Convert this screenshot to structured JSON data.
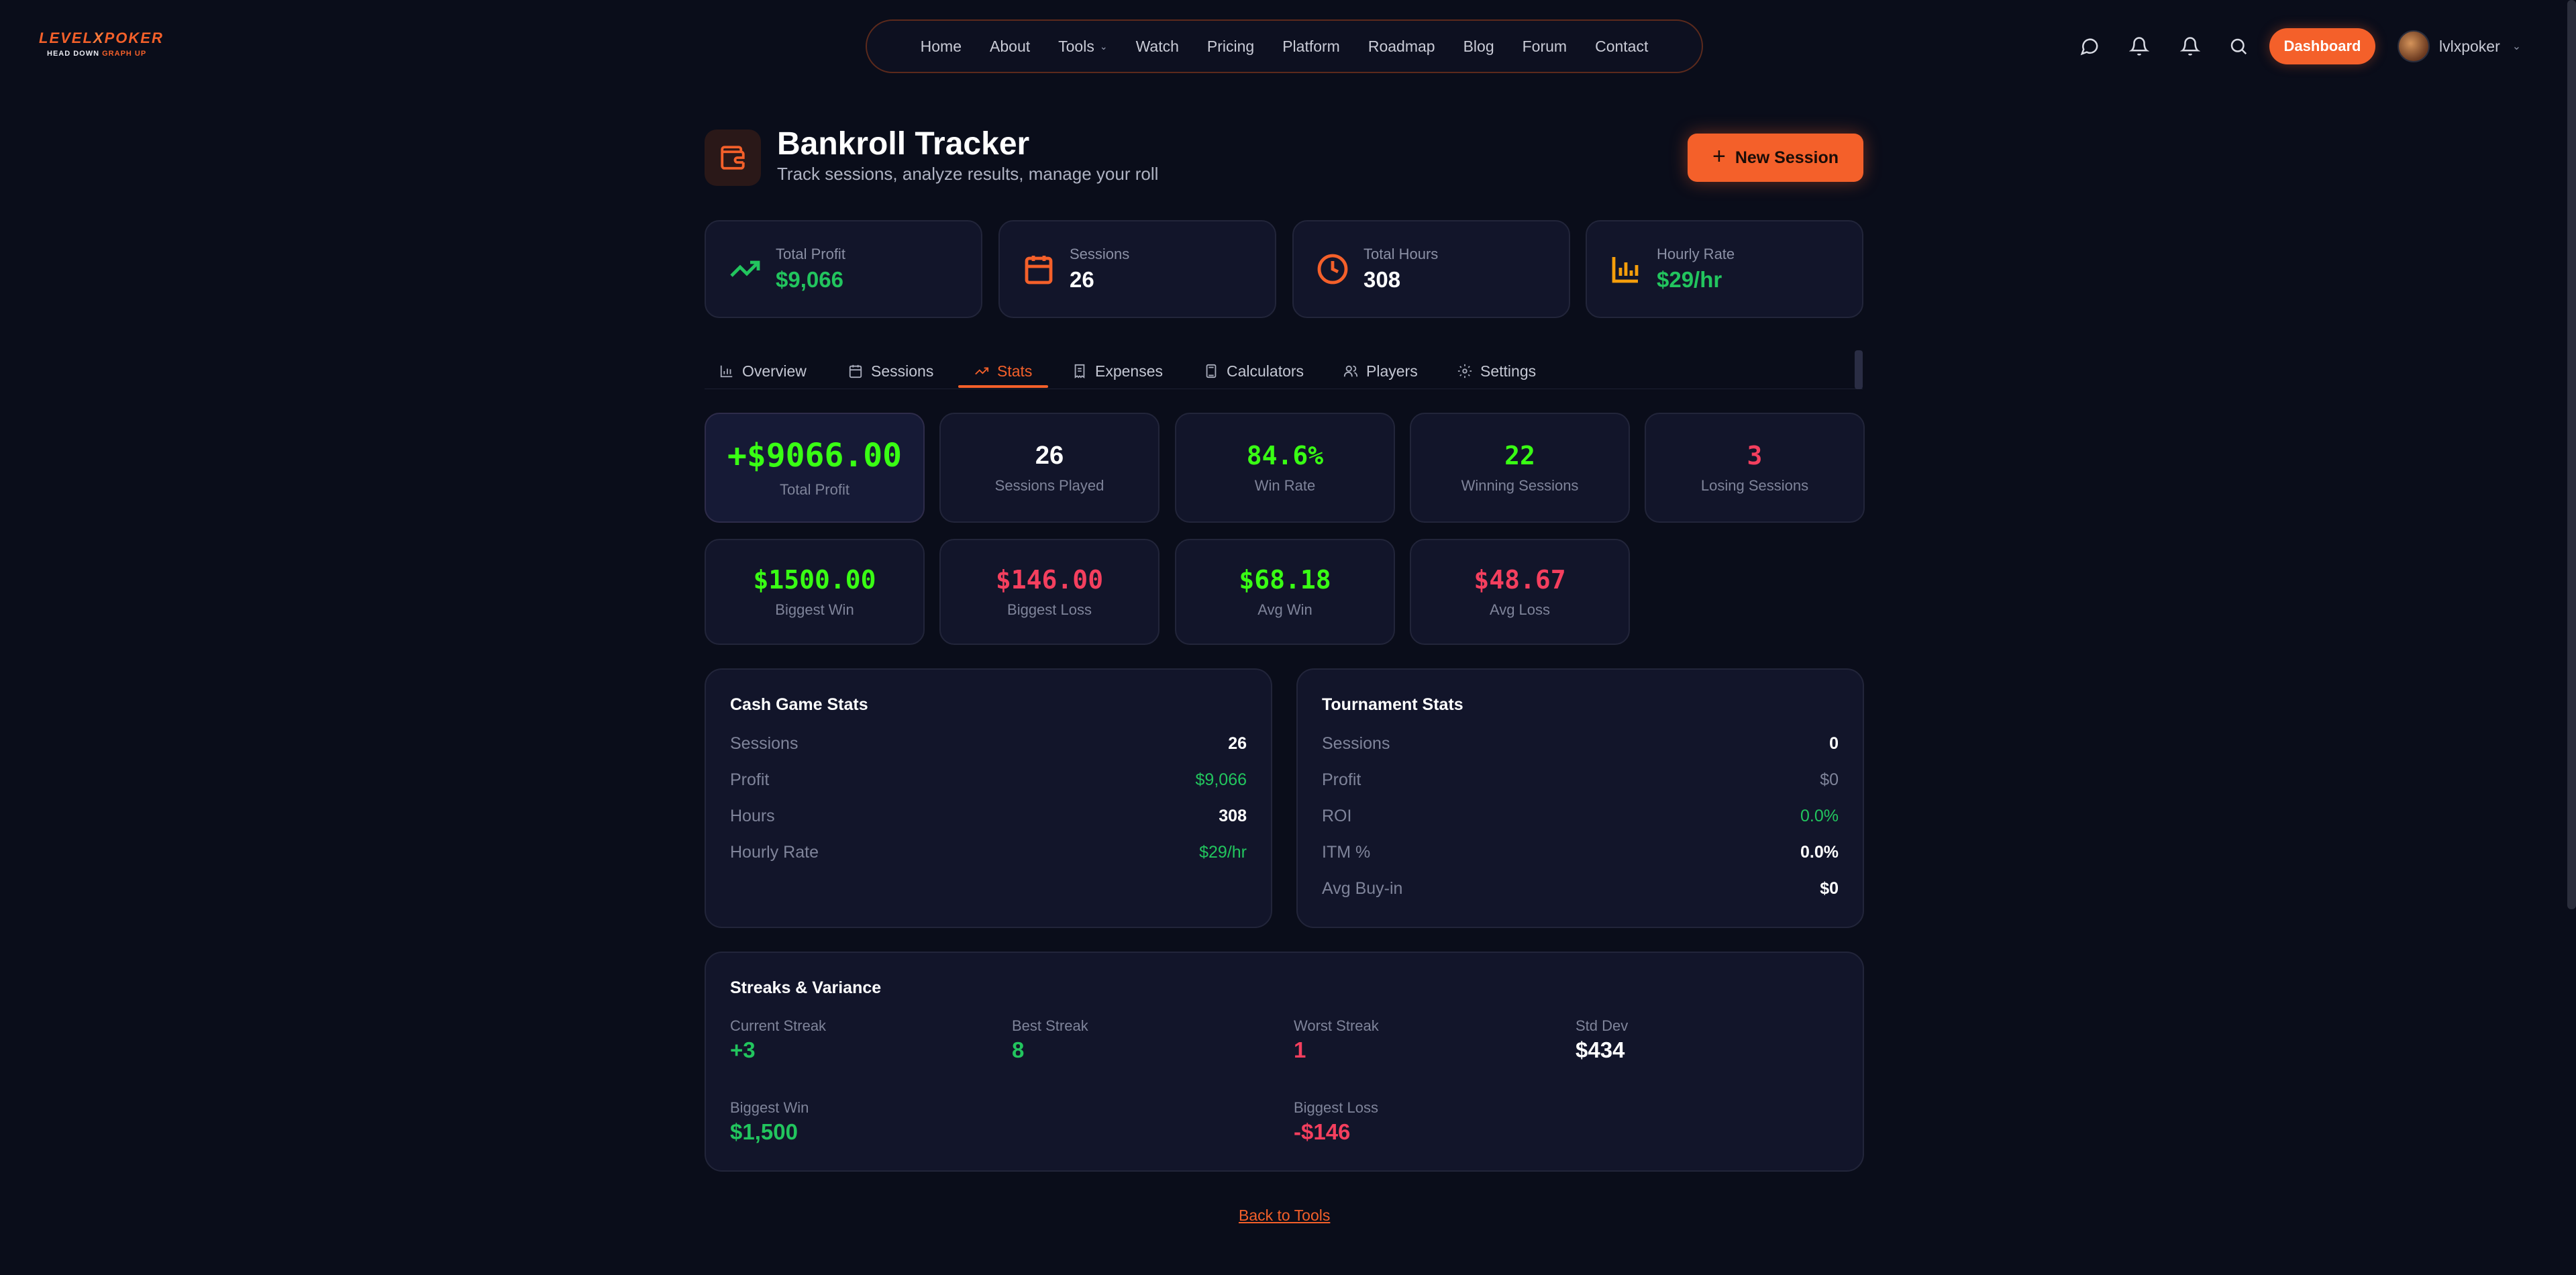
{
  "logo": {
    "line1": "LEVEL",
    "x": "X",
    "line1b": "POKER",
    "tagline_a": "HEAD DOWN",
    "tagline_b": "GRAPH UP"
  },
  "nav": {
    "items": [
      "Home",
      "About",
      "Tools",
      "Watch",
      "Pricing",
      "Platform",
      "Roadmap",
      "Blog",
      "Forum",
      "Contact"
    ]
  },
  "header": {
    "dashboard_label": "Dashboard",
    "username": "lvlxpoker"
  },
  "page": {
    "title": "Bankroll Tracker",
    "subtitle": "Track sessions, analyze results, manage your roll",
    "new_session_label": "New Session"
  },
  "summary": [
    {
      "label": "Total Profit",
      "value": "$9,066",
      "color": "#22c55e",
      "icon": "trending-up-icon"
    },
    {
      "label": "Sessions",
      "value": "26",
      "color": "#ffffff",
      "icon": "calendar-icon"
    },
    {
      "label": "Total Hours",
      "value": "308",
      "color": "#ffffff",
      "icon": "clock-icon"
    },
    {
      "label": "Hourly Rate",
      "value": "$29/hr",
      "color": "#22c55e",
      "icon": "bar-chart-icon"
    }
  ],
  "tabs": [
    {
      "label": "Overview",
      "icon": "bar-chart-icon"
    },
    {
      "label": "Sessions",
      "icon": "calendar-icon"
    },
    {
      "label": "Stats",
      "icon": "trending-up-icon",
      "active": true
    },
    {
      "label": "Expenses",
      "icon": "receipt-icon"
    },
    {
      "label": "Calculators",
      "icon": "calculator-icon"
    },
    {
      "label": "Players",
      "icon": "users-icon"
    },
    {
      "label": "Settings",
      "icon": "gear-icon"
    }
  ],
  "stats_row1": [
    {
      "value": "+$9066.00",
      "caption": "Total Profit"
    },
    {
      "value": "26",
      "caption": "Sessions Played"
    },
    {
      "value": "84.6%",
      "caption": "Win Rate"
    },
    {
      "value": "22",
      "caption": "Winning Sessions"
    },
    {
      "value": "3",
      "caption": "Losing Sessions"
    }
  ],
  "stats_row2": [
    {
      "value": "$1500.00",
      "caption": "Biggest Win"
    },
    {
      "value": "$146.00",
      "caption": "Biggest Loss"
    },
    {
      "value": "$68.18",
      "caption": "Avg Win"
    },
    {
      "value": "$48.67",
      "caption": "Avg Loss"
    }
  ],
  "cash": {
    "title": "Cash Game Stats",
    "rows": [
      {
        "k": "Sessions",
        "v": "26"
      },
      {
        "k": "Profit",
        "v": "$9,066"
      },
      {
        "k": "Hours",
        "v": "308"
      },
      {
        "k": "Hourly Rate",
        "v": "$29/hr"
      }
    ]
  },
  "tournament": {
    "title": "Tournament Stats",
    "rows": [
      {
        "k": "Sessions",
        "v": "0"
      },
      {
        "k": "Profit",
        "v": "$0"
      },
      {
        "k": "ROI",
        "v": "0.0%"
      },
      {
        "k": "ITM %",
        "v": "0.0%"
      },
      {
        "k": "Avg Buy-in",
        "v": "$0"
      }
    ]
  },
  "streaks": {
    "title": "Streaks & Variance",
    "current_streak": {
      "label": "Current Streak",
      "value": "+3"
    },
    "best_streak": {
      "label": "Best Streak",
      "value": "8"
    },
    "worst_streak": {
      "label": "Worst Streak",
      "value": "1"
    },
    "std_dev": {
      "label": "Std Dev",
      "value": "$434"
    },
    "biggest_win": {
      "label": "Biggest Win",
      "value": "$1,500"
    },
    "biggest_loss": {
      "label": "Biggest Loss",
      "value": "-$146"
    }
  },
  "footer": {
    "back_link": "Back to Tools"
  },
  "colors": {
    "accent": "#f4602a",
    "green": "#22c55e",
    "neon_green": "#39ff14",
    "red": "#f43f5e",
    "bg": "#0a0d1a",
    "card": "#12152a"
  }
}
